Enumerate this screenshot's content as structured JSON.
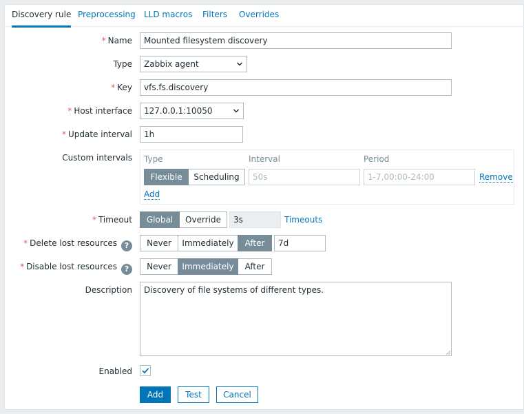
{
  "tabs": [
    {
      "label": "Discovery rule",
      "active": true
    },
    {
      "label": "Preprocessing",
      "active": false
    },
    {
      "label": "LLD macros",
      "active": false
    },
    {
      "label": "Filters",
      "active": false
    },
    {
      "label": "Overrides",
      "active": false
    }
  ],
  "form": {
    "required_mark": "*",
    "name": {
      "label": "Name",
      "value": "Mounted filesystem discovery"
    },
    "type": {
      "label": "Type",
      "value": "Zabbix agent"
    },
    "key": {
      "label": "Key",
      "value": "vfs.fs.discovery"
    },
    "host_interface": {
      "label": "Host interface",
      "value": "127.0.0.1:10050"
    },
    "update_interval": {
      "label": "Update interval",
      "value": "1h"
    },
    "custom_intervals": {
      "label": "Custom intervals",
      "col_type": "Type",
      "col_interval": "Interval",
      "col_period": "Period",
      "type_options": [
        "Flexible",
        "Scheduling"
      ],
      "type_selected": "Flexible",
      "interval_placeholder": "50s",
      "period_placeholder": "1-7,00:00-24:00",
      "remove_label": "Remove",
      "add_label": "Add"
    },
    "timeout": {
      "label": "Timeout",
      "options": [
        "Global",
        "Override"
      ],
      "selected": "Global",
      "value": "3s",
      "link": "Timeouts"
    },
    "delete_lost": {
      "label": "Delete lost resources",
      "help": "?",
      "options": [
        "Never",
        "Immediately",
        "After"
      ],
      "selected": "After",
      "value": "7d"
    },
    "disable_lost": {
      "label": "Disable lost resources",
      "help": "?",
      "options": [
        "Never",
        "Immediately",
        "After"
      ],
      "selected": "Immediately"
    },
    "description": {
      "label": "Description",
      "value": "Discovery of file systems of different types."
    },
    "enabled": {
      "label": "Enabled",
      "checked": true
    }
  },
  "buttons": {
    "add": "Add",
    "test": "Test",
    "cancel": "Cancel"
  },
  "icons": {
    "select_arrow": "chevron-down-icon",
    "checkbox": "checkmark-icon",
    "help": "question-icon",
    "resize": "resize-grip-icon"
  },
  "colors": {
    "accent": "#0275b8",
    "required": "#e45959",
    "selected_segment": "#768d99",
    "background": "#ebeef0"
  }
}
